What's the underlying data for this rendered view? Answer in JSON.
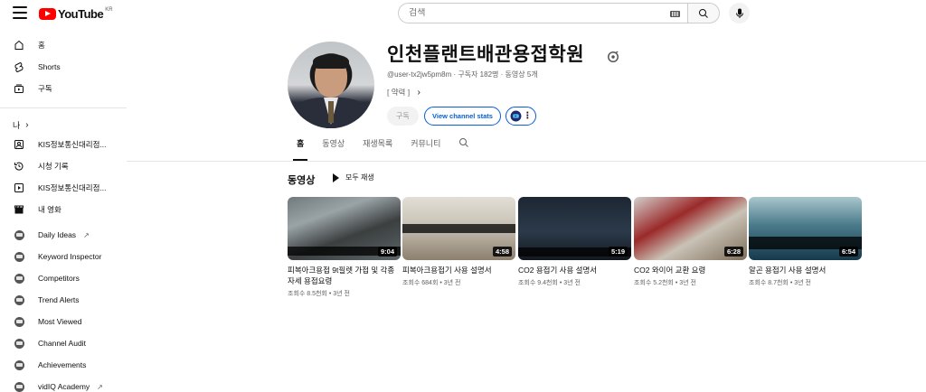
{
  "header": {
    "logo_text": "YouTube",
    "logo_region": "KR",
    "search_placeholder": "검색"
  },
  "sidebar": {
    "main": [
      {
        "label": "홈",
        "icon": "home-icon"
      },
      {
        "label": "Shorts",
        "icon": "shorts-icon"
      },
      {
        "label": "구독",
        "icon": "subscriptions-icon"
      }
    ],
    "you_label": "나",
    "you": [
      {
        "label": "KIS정보통신대리점...",
        "icon": "channel-icon"
      },
      {
        "label": "시청 기록",
        "icon": "history-icon"
      },
      {
        "label": "KIS정보통신대리점...",
        "icon": "video-icon"
      },
      {
        "label": "내 영화",
        "icon": "movie-icon"
      }
    ],
    "vidiq": [
      {
        "label": "Daily Ideas",
        "external": true
      },
      {
        "label": "Keyword Inspector",
        "external": false
      },
      {
        "label": "Competitors",
        "external": false
      },
      {
        "label": "Trend Alerts",
        "external": false
      },
      {
        "label": "Most Viewed",
        "external": false
      },
      {
        "label": "Channel Audit",
        "external": false
      },
      {
        "label": "Achievements",
        "external": false
      },
      {
        "label": "vidIQ Academy",
        "external": true
      }
    ]
  },
  "channel": {
    "title": "인천플랜트배관용접학원",
    "handle": "@user-tx2jw5pm8m",
    "subscribers": "구독자 182명",
    "video_count": "동영상 5개",
    "about": "[ 약력 ]",
    "subscribe_label": "구독",
    "stats_label": "View channel stats"
  },
  "tabs": [
    {
      "label": "홈",
      "active": true
    },
    {
      "label": "동영상",
      "active": false
    },
    {
      "label": "재생목록",
      "active": false
    },
    {
      "label": "커뮤니티",
      "active": false
    }
  ],
  "section": {
    "title": "동영상",
    "play_all": "모두 재생"
  },
  "videos": [
    {
      "title": "피복아크용접 9t필렛 가접 및 각종자세 용접요령",
      "duration": "9:04",
      "views": "조회수 8.5천회",
      "age": "3년 전"
    },
    {
      "title": "피복아크용접기 사용 설명서",
      "duration": "4:58",
      "views": "조회수 684회",
      "age": "3년 전"
    },
    {
      "title": "CO2 용접기 사용 설명서",
      "duration": "5:19",
      "views": "조회수 9.4천회",
      "age": "3년 전"
    },
    {
      "title": "CO2 와이어 교환 요령",
      "duration": "6:28",
      "views": "조회수 5.2천회",
      "age": "3년 전"
    },
    {
      "title": "알곤 용접기 사용 설명서",
      "duration": "6:54",
      "views": "조회수 8.7천회",
      "age": "3년 전"
    }
  ],
  "colors": {
    "brand_red": "#ff0000",
    "accent_blue": "#065fd4",
    "text_secondary": "#606060"
  }
}
